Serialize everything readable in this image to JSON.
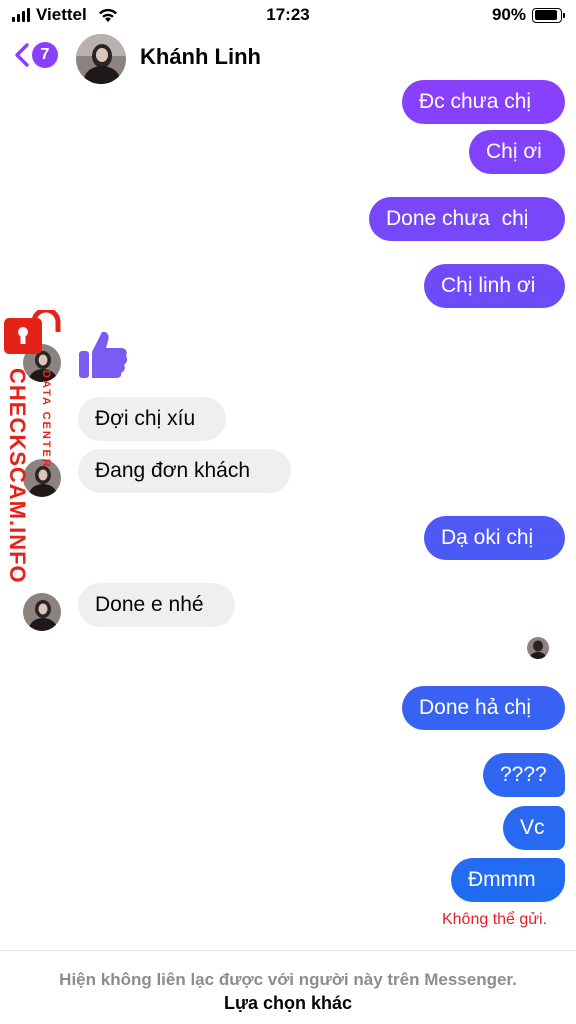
{
  "status_bar": {
    "carrier": "Viettel",
    "time": "17:23",
    "battery_percent": "90%",
    "battery_level": 0.9,
    "icons": [
      "signal-bars-icon",
      "wifi-icon",
      "battery-icon"
    ]
  },
  "header": {
    "back_icon": "chevron-left-icon",
    "unread_count": "7",
    "contact_name": "Khánh Linh",
    "accent_color": "#8a3ffc"
  },
  "messages": [
    {
      "direction": "sent",
      "text": "Đc chưa chị"
    },
    {
      "direction": "sent",
      "text": "Chị ơi"
    },
    {
      "direction": "sent",
      "text": "Done chưa  chị"
    },
    {
      "direction": "sent",
      "text": "Chị linh ơi"
    },
    {
      "direction": "received",
      "sticker": "thumbs-up-icon"
    },
    {
      "direction": "received",
      "text": "Đợi chị xíu"
    },
    {
      "direction": "received",
      "text": "Đang đơn khách"
    },
    {
      "direction": "sent",
      "text": "Dạ oki chị"
    },
    {
      "direction": "received",
      "text": "Done e nhé"
    },
    {
      "direction": "sent",
      "text": "Done hả chị"
    },
    {
      "direction": "sent",
      "text": "????"
    },
    {
      "direction": "sent",
      "text": "Vc"
    },
    {
      "direction": "sent",
      "text": "Đmmm"
    }
  ],
  "send_error": "Không thể gửi.",
  "watermark": {
    "brand": "CHECKSCAM.INFO",
    "subtitle": "DATA CENTER",
    "color": "#e52218"
  },
  "footer": {
    "info": "Hiện không liên lạc được với người này trên Messenger.",
    "action": "Lựa chọn khác"
  },
  "colors": {
    "sent_bubble_top": "#8a3ffc",
    "sent_bubble_bottom": "#1f6df0",
    "received_bubble": "#efefef",
    "error": "#e4202f"
  }
}
